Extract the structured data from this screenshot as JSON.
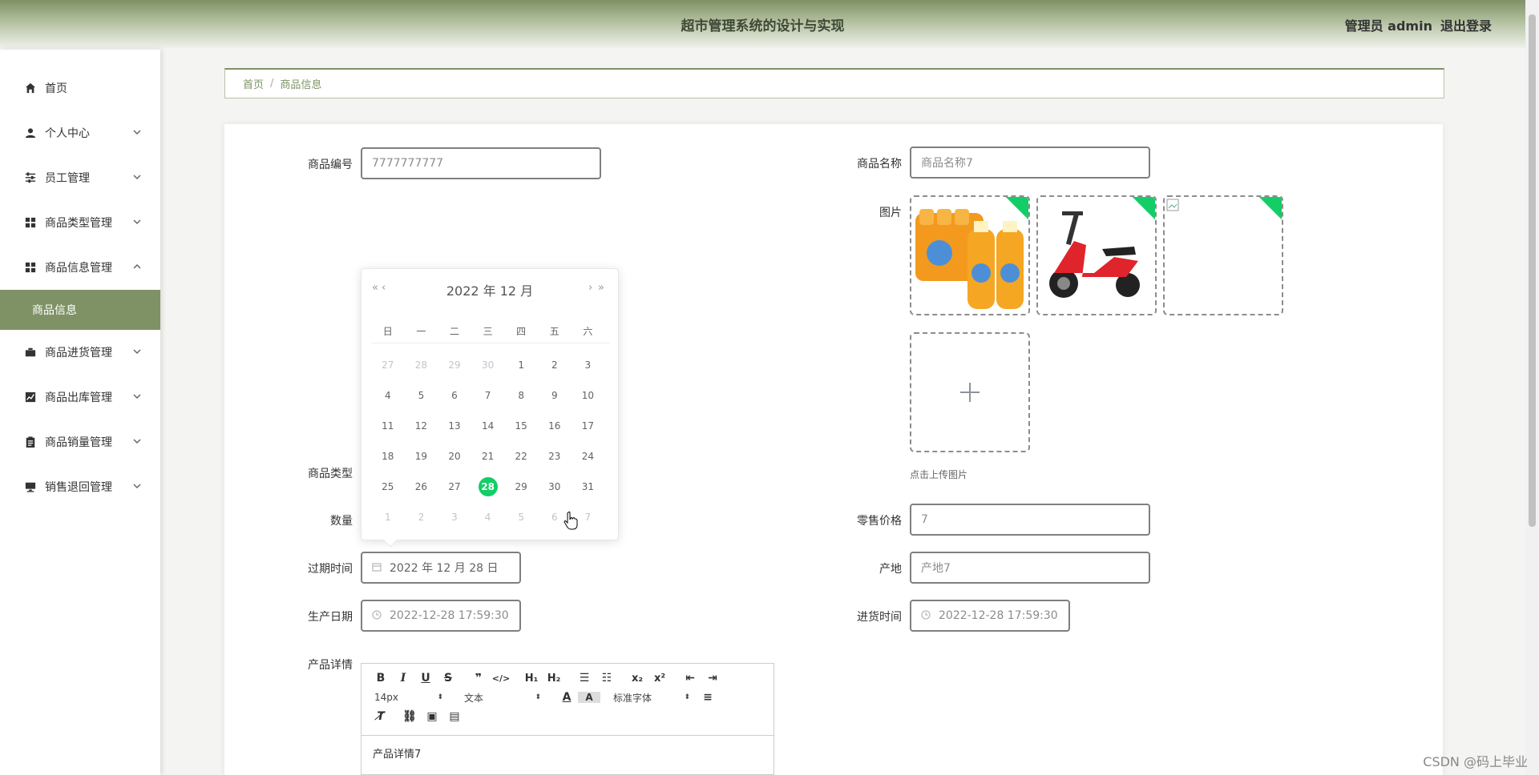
{
  "header": {
    "title": "超市管理系统的设计与实现",
    "role_user": "管理员 admin",
    "logout": "退出登录"
  },
  "sidebar": {
    "items": [
      {
        "label": "首页"
      },
      {
        "label": "个人中心"
      },
      {
        "label": "员工管理"
      },
      {
        "label": "商品类型管理"
      },
      {
        "label": "商品信息管理"
      },
      {
        "label": "商品信息"
      },
      {
        "label": "商品进货管理"
      },
      {
        "label": "商品出库管理"
      },
      {
        "label": "商品销量管理"
      },
      {
        "label": "销售退回管理"
      }
    ]
  },
  "breadcrumb": {
    "home": "首页",
    "sep": "/",
    "current": "商品信息"
  },
  "form": {
    "code_label": "商品编号",
    "code_value": "7777777777",
    "name_label": "商品名称",
    "name_value": "商品名称7",
    "image_label": "图片",
    "upload_hint": "点击上传图片",
    "type_label": "商品类型",
    "qty_label": "数量",
    "price_label": "零售价格",
    "price_value": "7",
    "expire_label": "过期时间",
    "expire_value": "2022 年 12 月 28 日",
    "origin_label": "产地",
    "origin_value": "产地7",
    "prod_label": "生产日期",
    "prod_value": "2022-12-28 17:59:30",
    "purchase_label": "进货时间",
    "purchase_value": "2022-12-28 17:59:30",
    "detail_label": "产品详情",
    "detail_value": "产品详情7"
  },
  "calendar": {
    "header": "2022 年  12 月",
    "prev_year": "«",
    "prev_month": "‹",
    "next_month": "›",
    "next_year": "»",
    "weekdays": [
      "日",
      "一",
      "二",
      "三",
      "四",
      "五",
      "六"
    ],
    "weeks": [
      [
        "27",
        "28",
        "29",
        "30",
        "1",
        "2",
        "3"
      ],
      [
        "4",
        "5",
        "6",
        "7",
        "8",
        "9",
        "10"
      ],
      [
        "11",
        "12",
        "13",
        "14",
        "15",
        "16",
        "17"
      ],
      [
        "18",
        "19",
        "20",
        "21",
        "22",
        "23",
        "24"
      ],
      [
        "25",
        "26",
        "27",
        "28",
        "29",
        "30",
        "31"
      ],
      [
        "1",
        "2",
        "3",
        "4",
        "5",
        "6",
        "7"
      ]
    ],
    "selected": "28"
  },
  "editor": {
    "font_size": "14px",
    "block": "文本",
    "font_family": "标准字体"
  },
  "watermark": "CSDN @码上毕业",
  "colors": {
    "theme": "#7e9265",
    "selected": "#13ce66"
  }
}
